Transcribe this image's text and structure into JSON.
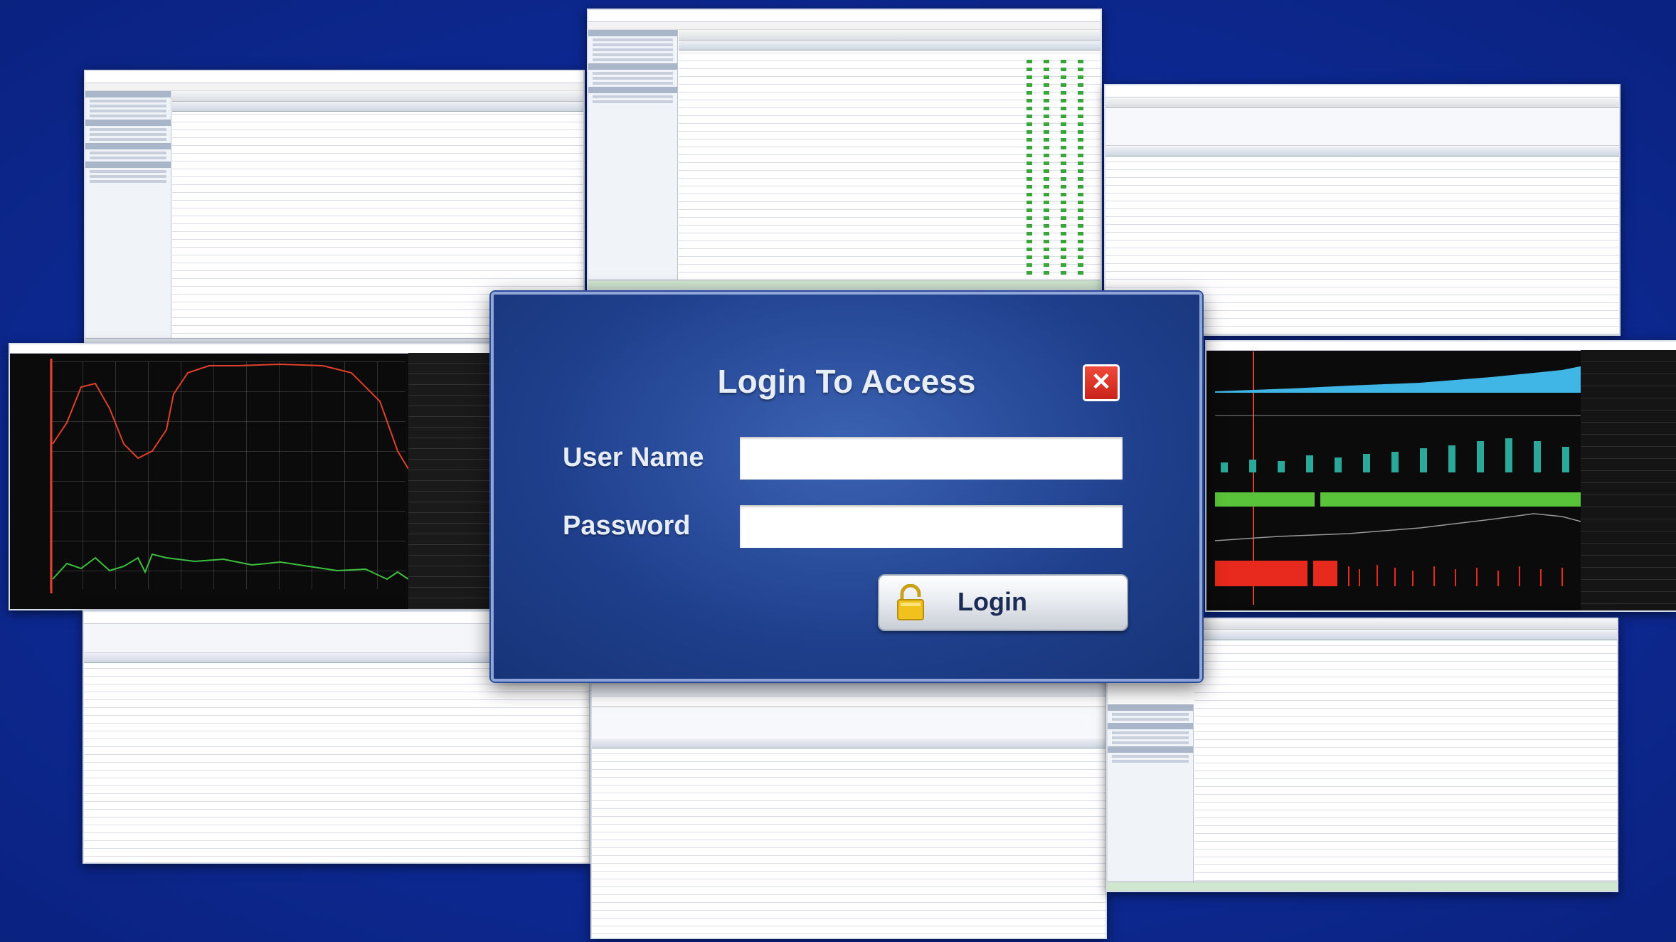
{
  "login": {
    "title": "Login To Access",
    "close_symbol": "✕",
    "username_label": "User Name",
    "password_label": "Password",
    "username_value": "",
    "password_value": "",
    "login_label": "Login"
  },
  "icons": {
    "close": "close-icon",
    "lock": "padlock-icon"
  },
  "colors": {
    "background": "#0d2a95",
    "dialog": "#2a4d9f",
    "close_button": "#d9302a",
    "trace_red": "#e0402c",
    "trace_green": "#3cbf3c",
    "area_blue": "#3fb6e6",
    "bars_teal": "#2aa89a",
    "band_green": "#59c43a",
    "bars_red": "#e8291d"
  }
}
